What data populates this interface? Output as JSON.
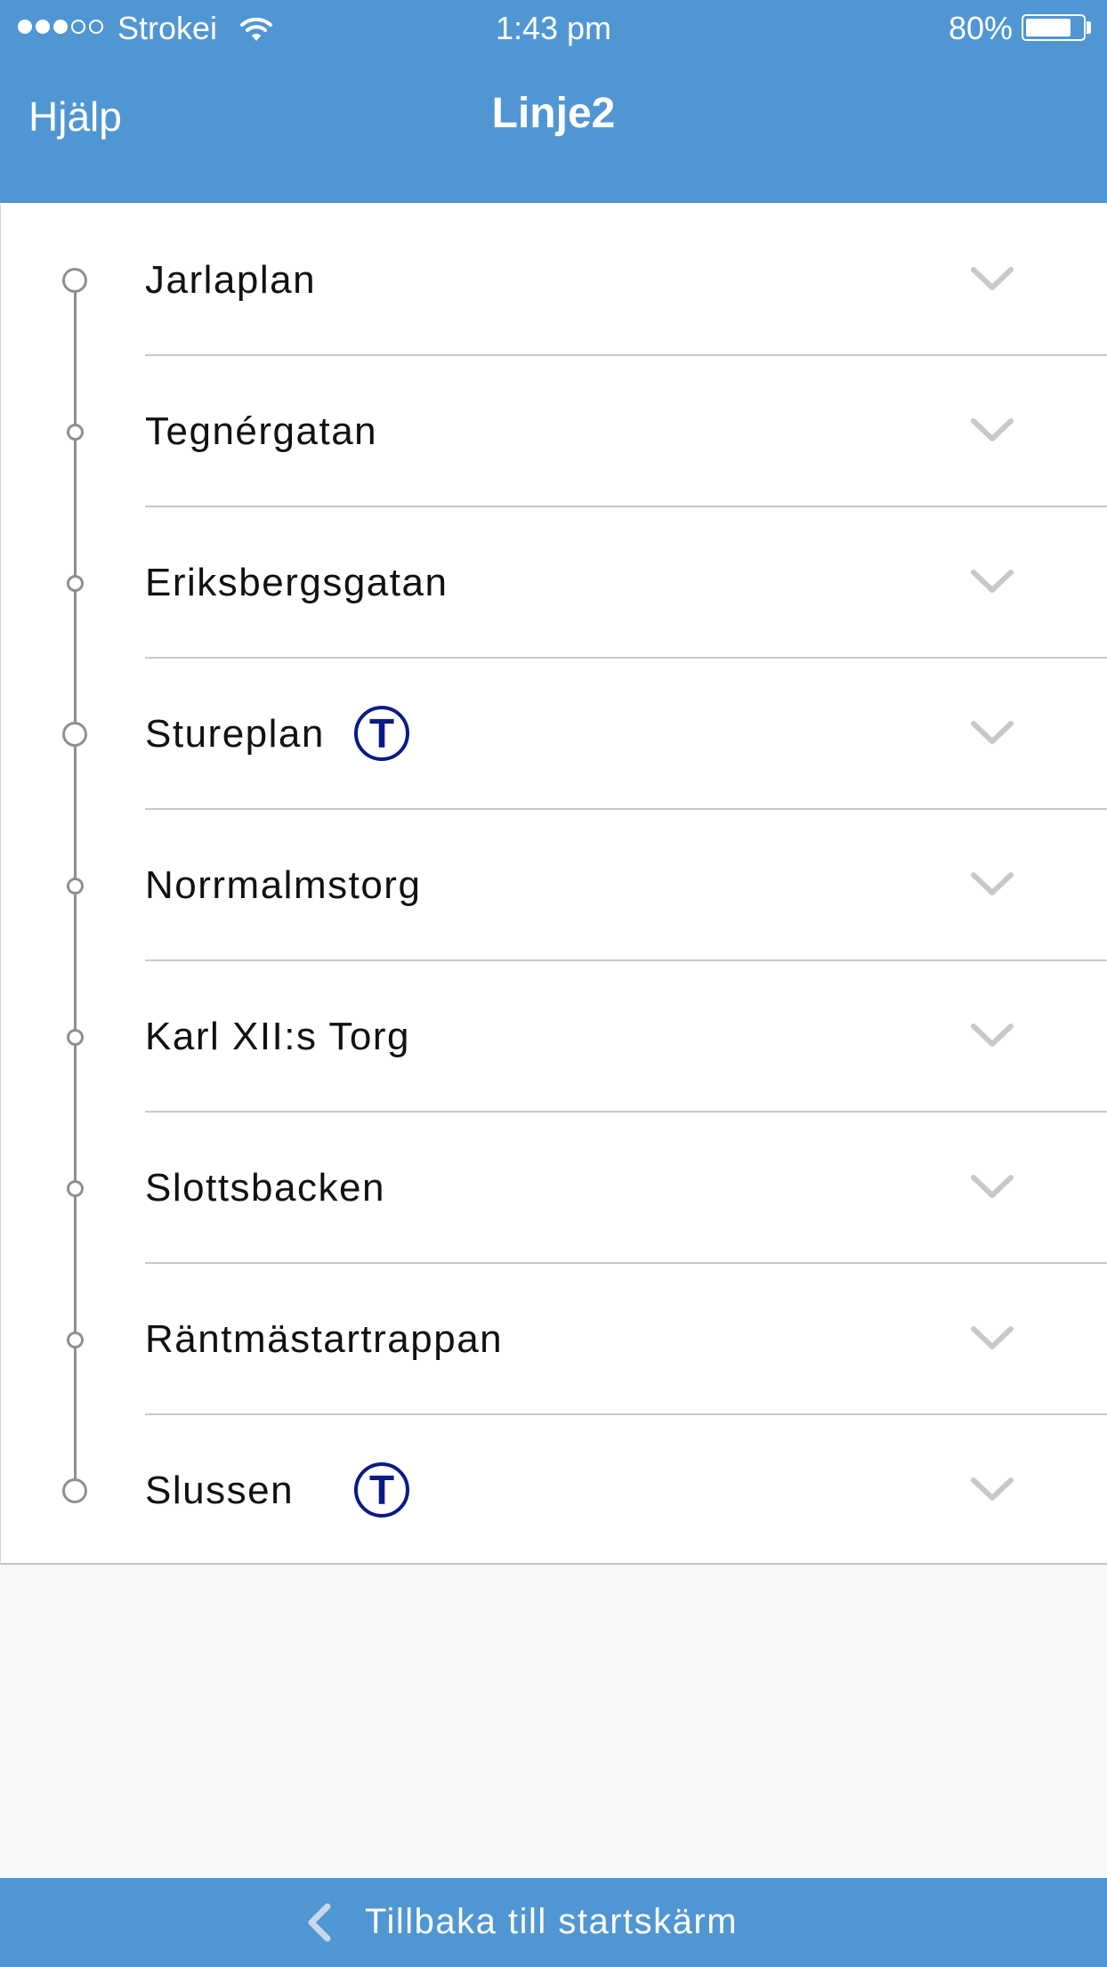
{
  "status_bar": {
    "carrier": "Strokei",
    "time": "1:43 pm",
    "battery_percent_text": "80%",
    "battery_level": 0.8,
    "signal_bars_on": 3,
    "signal_bars_total": 5
  },
  "header": {
    "help_label": "Hjälp",
    "title": "Linje2"
  },
  "stops": [
    {
      "name": "Jarlaplan",
      "metro": false,
      "major": true
    },
    {
      "name": "Tegnérgatan",
      "metro": false,
      "major": false
    },
    {
      "name": "Eriksbergsgatan",
      "metro": false,
      "major": false
    },
    {
      "name": "Stureplan",
      "metro": true,
      "major": true
    },
    {
      "name": "Norrmalmstorg",
      "metro": false,
      "major": false
    },
    {
      "name": "Karl XII:s Torg",
      "metro": false,
      "major": false
    },
    {
      "name": "Slottsbacken",
      "metro": false,
      "major": false
    },
    {
      "name": "Räntmästartrappan",
      "metro": false,
      "major": false
    },
    {
      "name": "Slussen",
      "metro": true,
      "major": true
    }
  ],
  "metro_icon_letter": "T",
  "icons": {
    "expand": "chevron-down-icon",
    "metro": "metro-t-icon",
    "back": "chevron-left-icon"
  },
  "footer": {
    "back_label": "Tillbaka till startskärm"
  },
  "colors": {
    "brand_blue": "#5096d3",
    "metro_blue": "#0a1a86",
    "route_line": "#8f8f8f",
    "chevron": "#c8c8c8"
  }
}
